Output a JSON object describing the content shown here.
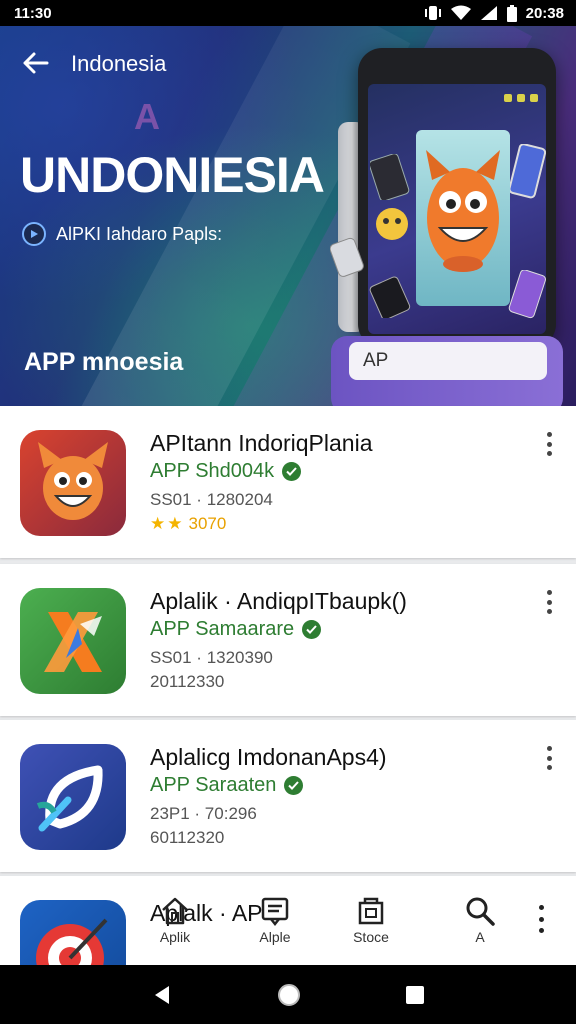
{
  "status_bar": {
    "time": "11:30",
    "clock_right": "20:38"
  },
  "header": {
    "nav_title": "Indonesia",
    "accent_letter": "A",
    "big_title": "UNDONIESIA",
    "tagline": "AlPKI Iahdaro Papls:",
    "bottom_title": "APP mnoesia",
    "search_value": "AP"
  },
  "apps": [
    {
      "title": "APItann IndoriqPlania",
      "developer": "APP Shd004k",
      "meta1": "SS01 · 1280204",
      "rating_stars": 2,
      "rating_text": "3070"
    },
    {
      "title": "Aplalik · AndiqpITbaupk()",
      "developer": "APP Samaarare",
      "meta1": "SS01 · 1320390",
      "meta2": "20112330"
    },
    {
      "title": "Aplalicg ImdonanAps4)",
      "developer": "APP Saraaten",
      "meta1": "23P1 · 70:296",
      "meta2": "60112320"
    },
    {
      "title": "Aplalk · AP"
    }
  ],
  "bottom_nav": {
    "items": [
      {
        "label": "Aplik",
        "icon": "home-icon"
      },
      {
        "label": "Alple",
        "icon": "news-icon"
      },
      {
        "label": "Stoce",
        "icon": "store-icon"
      },
      {
        "label": "A",
        "icon": "search-icon"
      }
    ]
  },
  "colors": {
    "developer_green": "#2e7d32",
    "star_yellow": "#f4b400",
    "search_panel": "#7a60cc"
  }
}
